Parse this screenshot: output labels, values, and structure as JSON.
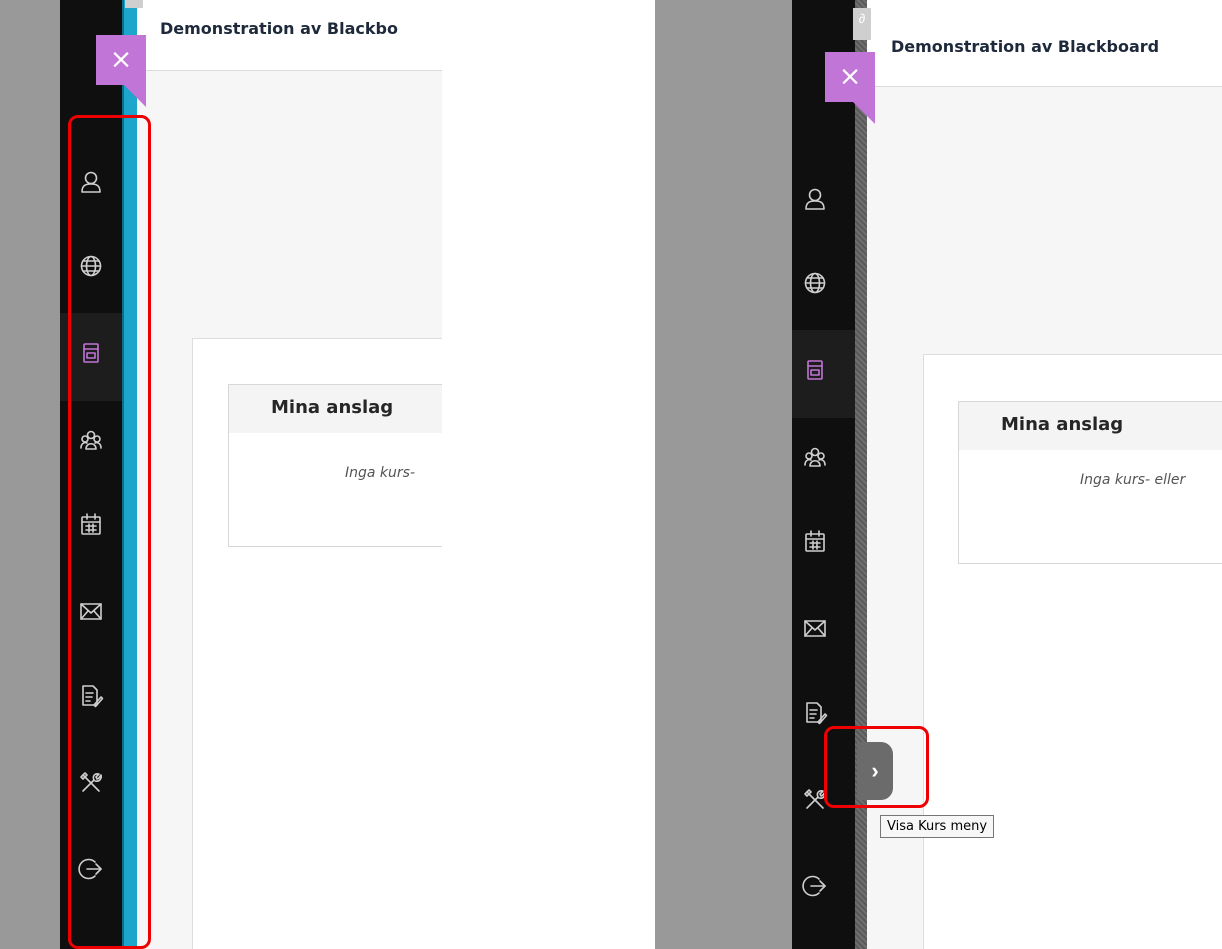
{
  "course": {
    "title_truncated": "Demonstration av Blackbo",
    "title": "Demonstration av Blackboard"
  },
  "close_button": {
    "label": "×"
  },
  "nav_icons": [
    "profile-icon",
    "globe-icon",
    "courses-icon",
    "groups-icon",
    "calendar-icon",
    "messages-icon",
    "grades-icon",
    "tools-icon",
    "logout-icon"
  ],
  "module": {
    "title": "Mina anslag",
    "empty_text_truncated": "Inga kurs-",
    "empty_text": "Inga kurs- eller"
  },
  "expand_button": {
    "label": "›"
  },
  "tooltip": {
    "text": "Visa Kurs meny"
  },
  "colors": {
    "nav_background": "#0f0f0f",
    "accent_purple": "#c175d6",
    "course_menu_stripe": "#1ea5cc",
    "highlight_red": "#ee0000",
    "page_gray": "#999999"
  }
}
